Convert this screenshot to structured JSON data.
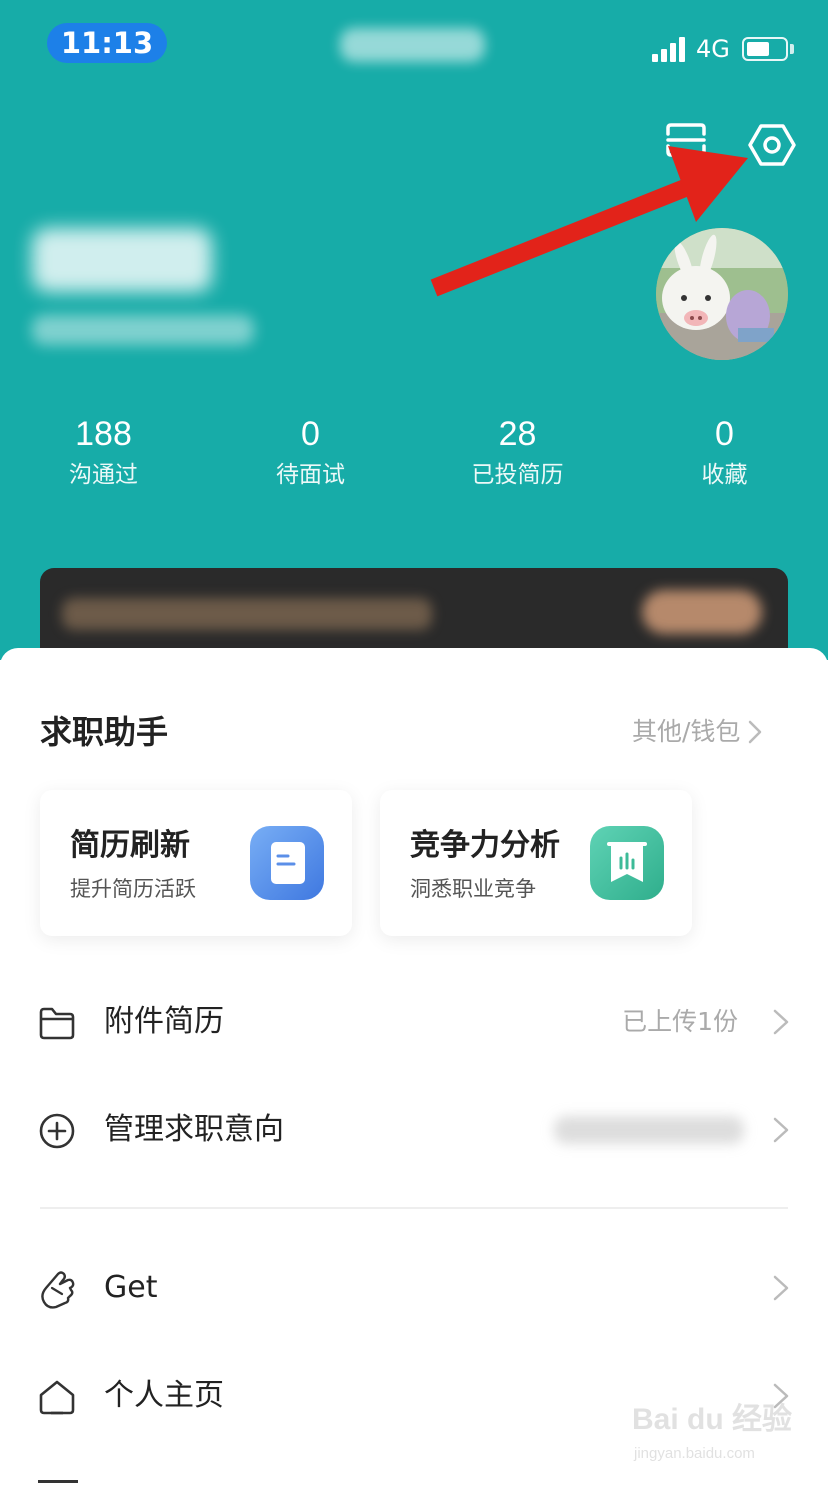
{
  "theme": {
    "accent": "#17aca8",
    "time_pill": "#1d80e8",
    "arrow": "#e2231a"
  },
  "status_bar": {
    "time": "11:13",
    "network": "4G",
    "battery_level": 0.6
  },
  "header": {
    "scan_icon": "scan-icon",
    "settings_icon": "settings-hexagon-icon",
    "stats": [
      {
        "value": "188",
        "label": "沟通过"
      },
      {
        "value": "0",
        "label": "待面试"
      },
      {
        "value": "28",
        "label": "已投简历"
      },
      {
        "value": "0",
        "label": "收藏"
      }
    ]
  },
  "assistant": {
    "title": "求职助手",
    "other_link": "其他/钱包",
    "cards": [
      {
        "title": "简历刷新",
        "subtitle": "提升简历活跃",
        "icon": "resume-refresh-icon"
      },
      {
        "title": "竞争力分析",
        "subtitle": "洞悉职业竞争",
        "icon": "competitiveness-chart-icon"
      }
    ]
  },
  "menu": [
    {
      "label": "附件简历",
      "value": "已上传1份",
      "icon": "folder-icon"
    },
    {
      "label": "管理求职意向",
      "value": "",
      "icon": "plus-circle-icon"
    },
    {
      "label": "Get",
      "value": "",
      "icon": "hand-gesture-icon"
    },
    {
      "label": "个人主页",
      "value": "",
      "icon": "home-icon"
    }
  ],
  "watermark": {
    "main": "Bai du 经验",
    "sub": "jingyan.baidu.com"
  }
}
